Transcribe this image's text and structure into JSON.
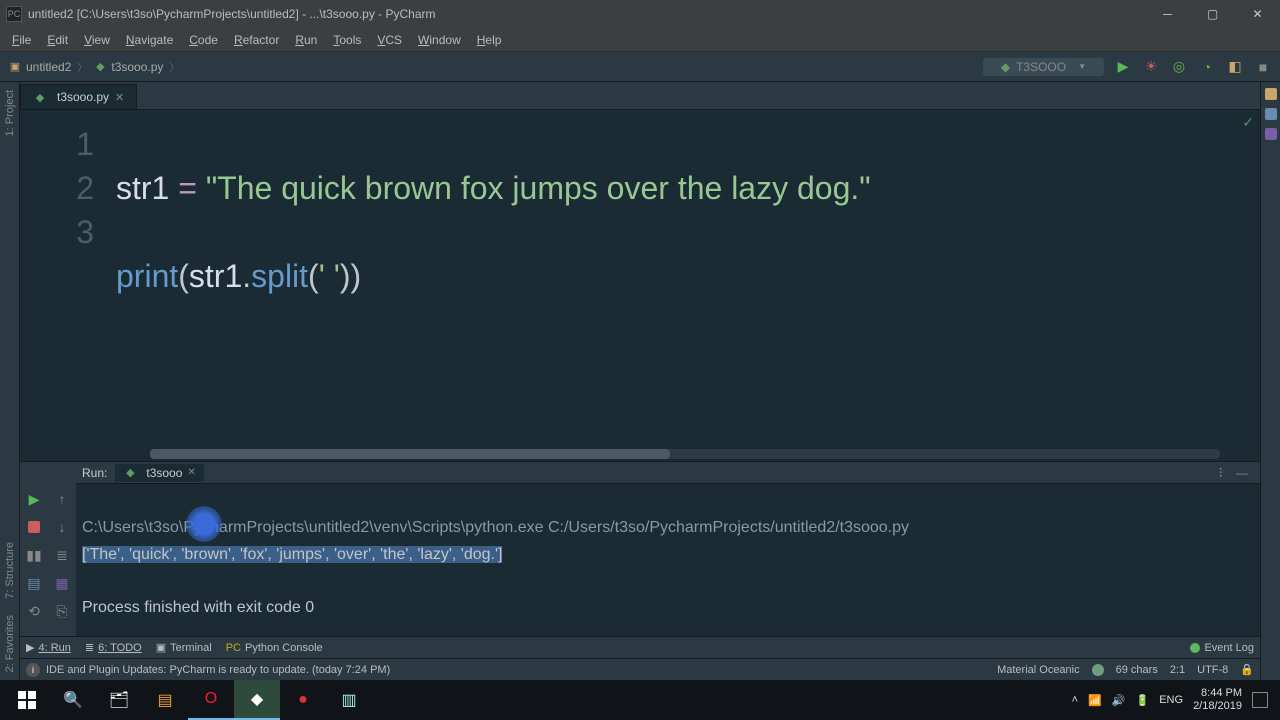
{
  "titlebar": {
    "title": "untitled2 [C:\\Users\\t3so\\PycharmProjects\\untitled2] - ...\\t3sooo.py - PyCharm"
  },
  "menus": [
    "File",
    "Edit",
    "View",
    "Navigate",
    "Code",
    "Refactor",
    "Run",
    "Tools",
    "VCS",
    "Window",
    "Help"
  ],
  "breadcrumb": {
    "project": "untitled2",
    "file": "t3sooo.py"
  },
  "runcfg": "T3SOOO",
  "tab": {
    "filename": "t3sooo.py"
  },
  "lines": [
    "1",
    "2",
    "3"
  ],
  "code": {
    "var": "str1",
    "eq": "=",
    "str": "\"The quick brown fox jumps over the lazy dog.\"",
    "fn": "print",
    "split_arg": "' '"
  },
  "run": {
    "label": "Run:",
    "tab": "t3sooo",
    "cmd": "C:\\Users\\t3so\\PycharmProjects\\untitled2\\venv\\Scripts\\python.exe C:/Users/t3so/PycharmProjects/untitled2/t3sooo.py",
    "out": "['The', 'quick', 'brown', 'fox', 'jumps', 'over', 'the', 'lazy', 'dog.']",
    "exit": "Process finished with exit code 0"
  },
  "bottom": {
    "run": "4: Run",
    "todo": "6: TODO",
    "terminal": "Terminal",
    "pyconsole": "Python Console",
    "eventlog": "Event Log"
  },
  "status": {
    "msg": "IDE and Plugin Updates: PyCharm is ready to update. (today 7:24 PM)",
    "theme": "Material Oceanic",
    "chars": "69 chars",
    "pos": "2:1",
    "enc": "UTF-8",
    "lock": "🔒"
  },
  "sidebars": {
    "left1": "1: Project",
    "left2": "7: Structure",
    "left3": "2: Favorites"
  },
  "tray": {
    "lang": "ENG",
    "time": "8:44 PM",
    "date": "2/18/2019"
  }
}
